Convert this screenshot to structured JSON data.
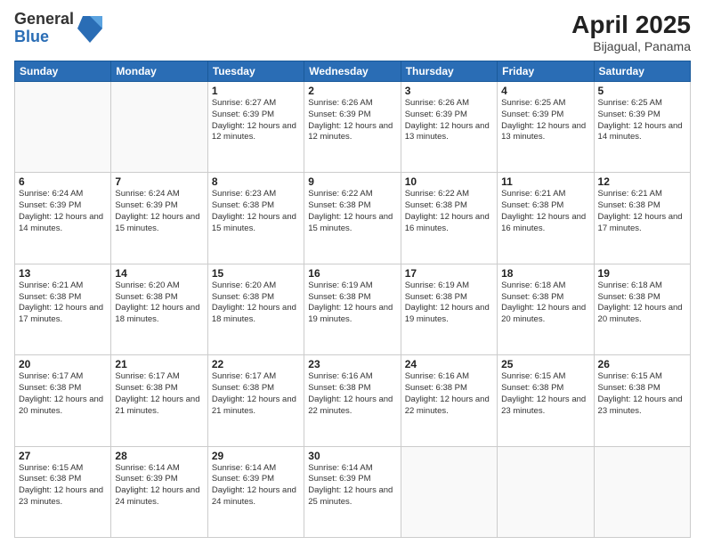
{
  "header": {
    "logo_general": "General",
    "logo_blue": "Blue",
    "title": "April 2025",
    "subtitle": "Bijagual, Panama"
  },
  "days_of_week": [
    "Sunday",
    "Monday",
    "Tuesday",
    "Wednesday",
    "Thursday",
    "Friday",
    "Saturday"
  ],
  "weeks": [
    [
      {
        "day": "",
        "sunrise": "",
        "sunset": "",
        "daylight": ""
      },
      {
        "day": "",
        "sunrise": "",
        "sunset": "",
        "daylight": ""
      },
      {
        "day": "1",
        "sunrise": "Sunrise: 6:27 AM",
        "sunset": "Sunset: 6:39 PM",
        "daylight": "Daylight: 12 hours and 12 minutes."
      },
      {
        "day": "2",
        "sunrise": "Sunrise: 6:26 AM",
        "sunset": "Sunset: 6:39 PM",
        "daylight": "Daylight: 12 hours and 12 minutes."
      },
      {
        "day": "3",
        "sunrise": "Sunrise: 6:26 AM",
        "sunset": "Sunset: 6:39 PM",
        "daylight": "Daylight: 12 hours and 13 minutes."
      },
      {
        "day": "4",
        "sunrise": "Sunrise: 6:25 AM",
        "sunset": "Sunset: 6:39 PM",
        "daylight": "Daylight: 12 hours and 13 minutes."
      },
      {
        "day": "5",
        "sunrise": "Sunrise: 6:25 AM",
        "sunset": "Sunset: 6:39 PM",
        "daylight": "Daylight: 12 hours and 14 minutes."
      }
    ],
    [
      {
        "day": "6",
        "sunrise": "Sunrise: 6:24 AM",
        "sunset": "Sunset: 6:39 PM",
        "daylight": "Daylight: 12 hours and 14 minutes."
      },
      {
        "day": "7",
        "sunrise": "Sunrise: 6:24 AM",
        "sunset": "Sunset: 6:39 PM",
        "daylight": "Daylight: 12 hours and 15 minutes."
      },
      {
        "day": "8",
        "sunrise": "Sunrise: 6:23 AM",
        "sunset": "Sunset: 6:38 PM",
        "daylight": "Daylight: 12 hours and 15 minutes."
      },
      {
        "day": "9",
        "sunrise": "Sunrise: 6:22 AM",
        "sunset": "Sunset: 6:38 PM",
        "daylight": "Daylight: 12 hours and 15 minutes."
      },
      {
        "day": "10",
        "sunrise": "Sunrise: 6:22 AM",
        "sunset": "Sunset: 6:38 PM",
        "daylight": "Daylight: 12 hours and 16 minutes."
      },
      {
        "day": "11",
        "sunrise": "Sunrise: 6:21 AM",
        "sunset": "Sunset: 6:38 PM",
        "daylight": "Daylight: 12 hours and 16 minutes."
      },
      {
        "day": "12",
        "sunrise": "Sunrise: 6:21 AM",
        "sunset": "Sunset: 6:38 PM",
        "daylight": "Daylight: 12 hours and 17 minutes."
      }
    ],
    [
      {
        "day": "13",
        "sunrise": "Sunrise: 6:21 AM",
        "sunset": "Sunset: 6:38 PM",
        "daylight": "Daylight: 12 hours and 17 minutes."
      },
      {
        "day": "14",
        "sunrise": "Sunrise: 6:20 AM",
        "sunset": "Sunset: 6:38 PM",
        "daylight": "Daylight: 12 hours and 18 minutes."
      },
      {
        "day": "15",
        "sunrise": "Sunrise: 6:20 AM",
        "sunset": "Sunset: 6:38 PM",
        "daylight": "Daylight: 12 hours and 18 minutes."
      },
      {
        "day": "16",
        "sunrise": "Sunrise: 6:19 AM",
        "sunset": "Sunset: 6:38 PM",
        "daylight": "Daylight: 12 hours and 19 minutes."
      },
      {
        "day": "17",
        "sunrise": "Sunrise: 6:19 AM",
        "sunset": "Sunset: 6:38 PM",
        "daylight": "Daylight: 12 hours and 19 minutes."
      },
      {
        "day": "18",
        "sunrise": "Sunrise: 6:18 AM",
        "sunset": "Sunset: 6:38 PM",
        "daylight": "Daylight: 12 hours and 20 minutes."
      },
      {
        "day": "19",
        "sunrise": "Sunrise: 6:18 AM",
        "sunset": "Sunset: 6:38 PM",
        "daylight": "Daylight: 12 hours and 20 minutes."
      }
    ],
    [
      {
        "day": "20",
        "sunrise": "Sunrise: 6:17 AM",
        "sunset": "Sunset: 6:38 PM",
        "daylight": "Daylight: 12 hours and 20 minutes."
      },
      {
        "day": "21",
        "sunrise": "Sunrise: 6:17 AM",
        "sunset": "Sunset: 6:38 PM",
        "daylight": "Daylight: 12 hours and 21 minutes."
      },
      {
        "day": "22",
        "sunrise": "Sunrise: 6:17 AM",
        "sunset": "Sunset: 6:38 PM",
        "daylight": "Daylight: 12 hours and 21 minutes."
      },
      {
        "day": "23",
        "sunrise": "Sunrise: 6:16 AM",
        "sunset": "Sunset: 6:38 PM",
        "daylight": "Daylight: 12 hours and 22 minutes."
      },
      {
        "day": "24",
        "sunrise": "Sunrise: 6:16 AM",
        "sunset": "Sunset: 6:38 PM",
        "daylight": "Daylight: 12 hours and 22 minutes."
      },
      {
        "day": "25",
        "sunrise": "Sunrise: 6:15 AM",
        "sunset": "Sunset: 6:38 PM",
        "daylight": "Daylight: 12 hours and 23 minutes."
      },
      {
        "day": "26",
        "sunrise": "Sunrise: 6:15 AM",
        "sunset": "Sunset: 6:38 PM",
        "daylight": "Daylight: 12 hours and 23 minutes."
      }
    ],
    [
      {
        "day": "27",
        "sunrise": "Sunrise: 6:15 AM",
        "sunset": "Sunset: 6:38 PM",
        "daylight": "Daylight: 12 hours and 23 minutes."
      },
      {
        "day": "28",
        "sunrise": "Sunrise: 6:14 AM",
        "sunset": "Sunset: 6:39 PM",
        "daylight": "Daylight: 12 hours and 24 minutes."
      },
      {
        "day": "29",
        "sunrise": "Sunrise: 6:14 AM",
        "sunset": "Sunset: 6:39 PM",
        "daylight": "Daylight: 12 hours and 24 minutes."
      },
      {
        "day": "30",
        "sunrise": "Sunrise: 6:14 AM",
        "sunset": "Sunset: 6:39 PM",
        "daylight": "Daylight: 12 hours and 25 minutes."
      },
      {
        "day": "",
        "sunrise": "",
        "sunset": "",
        "daylight": ""
      },
      {
        "day": "",
        "sunrise": "",
        "sunset": "",
        "daylight": ""
      },
      {
        "day": "",
        "sunrise": "",
        "sunset": "",
        "daylight": ""
      }
    ]
  ]
}
